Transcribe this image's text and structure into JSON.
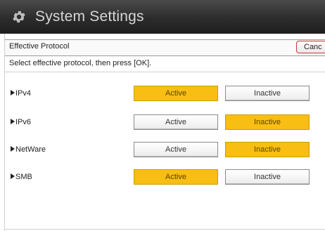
{
  "window": {
    "title": "System Settings",
    "icon": "gear-icon"
  },
  "header": {
    "label": "Effective Protocol",
    "cancel_label": "Canc"
  },
  "instruction": "Select effective protocol, then press [OK].",
  "options": {
    "active_label": "Active",
    "inactive_label": "Inactive"
  },
  "protocols": [
    {
      "label": "IPv4",
      "selected": "Active"
    },
    {
      "label": "IPv6",
      "selected": "Inactive"
    },
    {
      "label": "NetWare",
      "selected": "Inactive"
    },
    {
      "label": "SMB",
      "selected": "Active"
    }
  ],
  "colors": {
    "selected": "#f8be14",
    "titlebar": "#2c2c2c"
  }
}
